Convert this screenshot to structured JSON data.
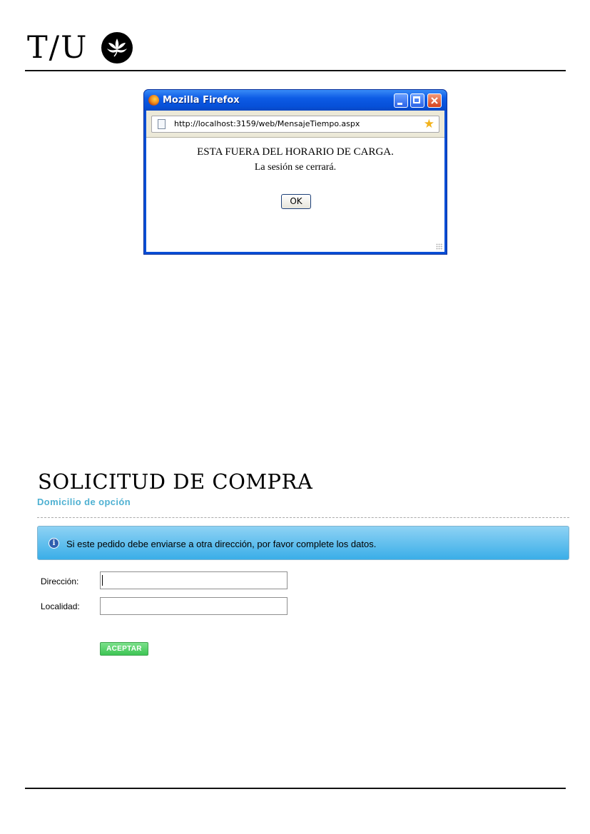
{
  "header": {
    "logo_text": "T/U"
  },
  "popup": {
    "window_title": "Mozilla Firefox",
    "url": "http://localhost:3159/web/MensajeTiempo.aspx",
    "message_line1": "ESTA FUERA DEL HORARIO DE CARGA.",
    "message_line2": "La sesión se cerrará.",
    "ok_label": "OK",
    "icons": [
      "firefox-logo",
      "minimize",
      "maximize",
      "close",
      "page",
      "bookmark-star",
      "resize-grip"
    ]
  },
  "form": {
    "title": "SOLICITUD DE COMPRA",
    "subtitle": "Domicilio de opción",
    "info_message": "Si este pedido debe enviarse a otra dirección, por favor complete los datos.",
    "fields": [
      {
        "label": "Dirección:",
        "value": ""
      },
      {
        "label": "Localidad:",
        "value": ""
      }
    ],
    "submit_label": "ACEPTAR"
  },
  "colors": {
    "accent": "#4fb1d2",
    "info_bg": "#3aaee8",
    "submit_bg": "#3ec554",
    "window_blue": "#0a4fd6"
  }
}
